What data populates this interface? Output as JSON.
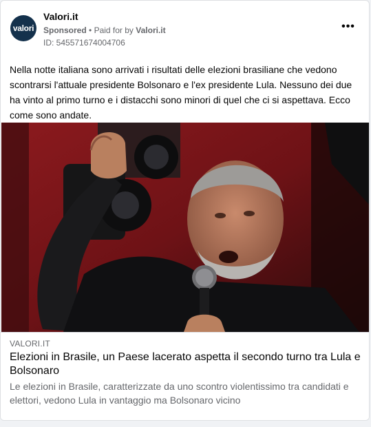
{
  "post": {
    "page_name": "Valori.it",
    "avatar_text": "valori",
    "sponsored_label": "Sponsored",
    "separator": "•",
    "paid_for_prefix": "Paid for by",
    "paid_for_name": "Valori.it",
    "id_text": "ID: 545571674004706",
    "more_label": "•••",
    "body": "Nella notte italiana sono arrivati i risultati delle elezioni brasiliane che vedono scontrarsi l'attuale presidente Bolsonaro e l'ex presidente Lula. Nessuno dei due ha vinto al primo turno e i distacchi sono minori di quel che ci si aspettava. Ecco come sono andate."
  },
  "link": {
    "domain": "VALORI.IT",
    "headline": "Elezioni in Brasile, un Paese lacerato aspetta il secondo turno tra Lula e Bolsonaro",
    "description": "Le elezioni in Brasile, caratterizzate da uno scontro violentissimo tra candidati e elettori, vedono Lula in vantaggio ma Bolsonaro vicino"
  },
  "colors": {
    "avatar_bg": "#14314c",
    "photo_bg": "#7b1419",
    "muted_text": "#65676b"
  }
}
